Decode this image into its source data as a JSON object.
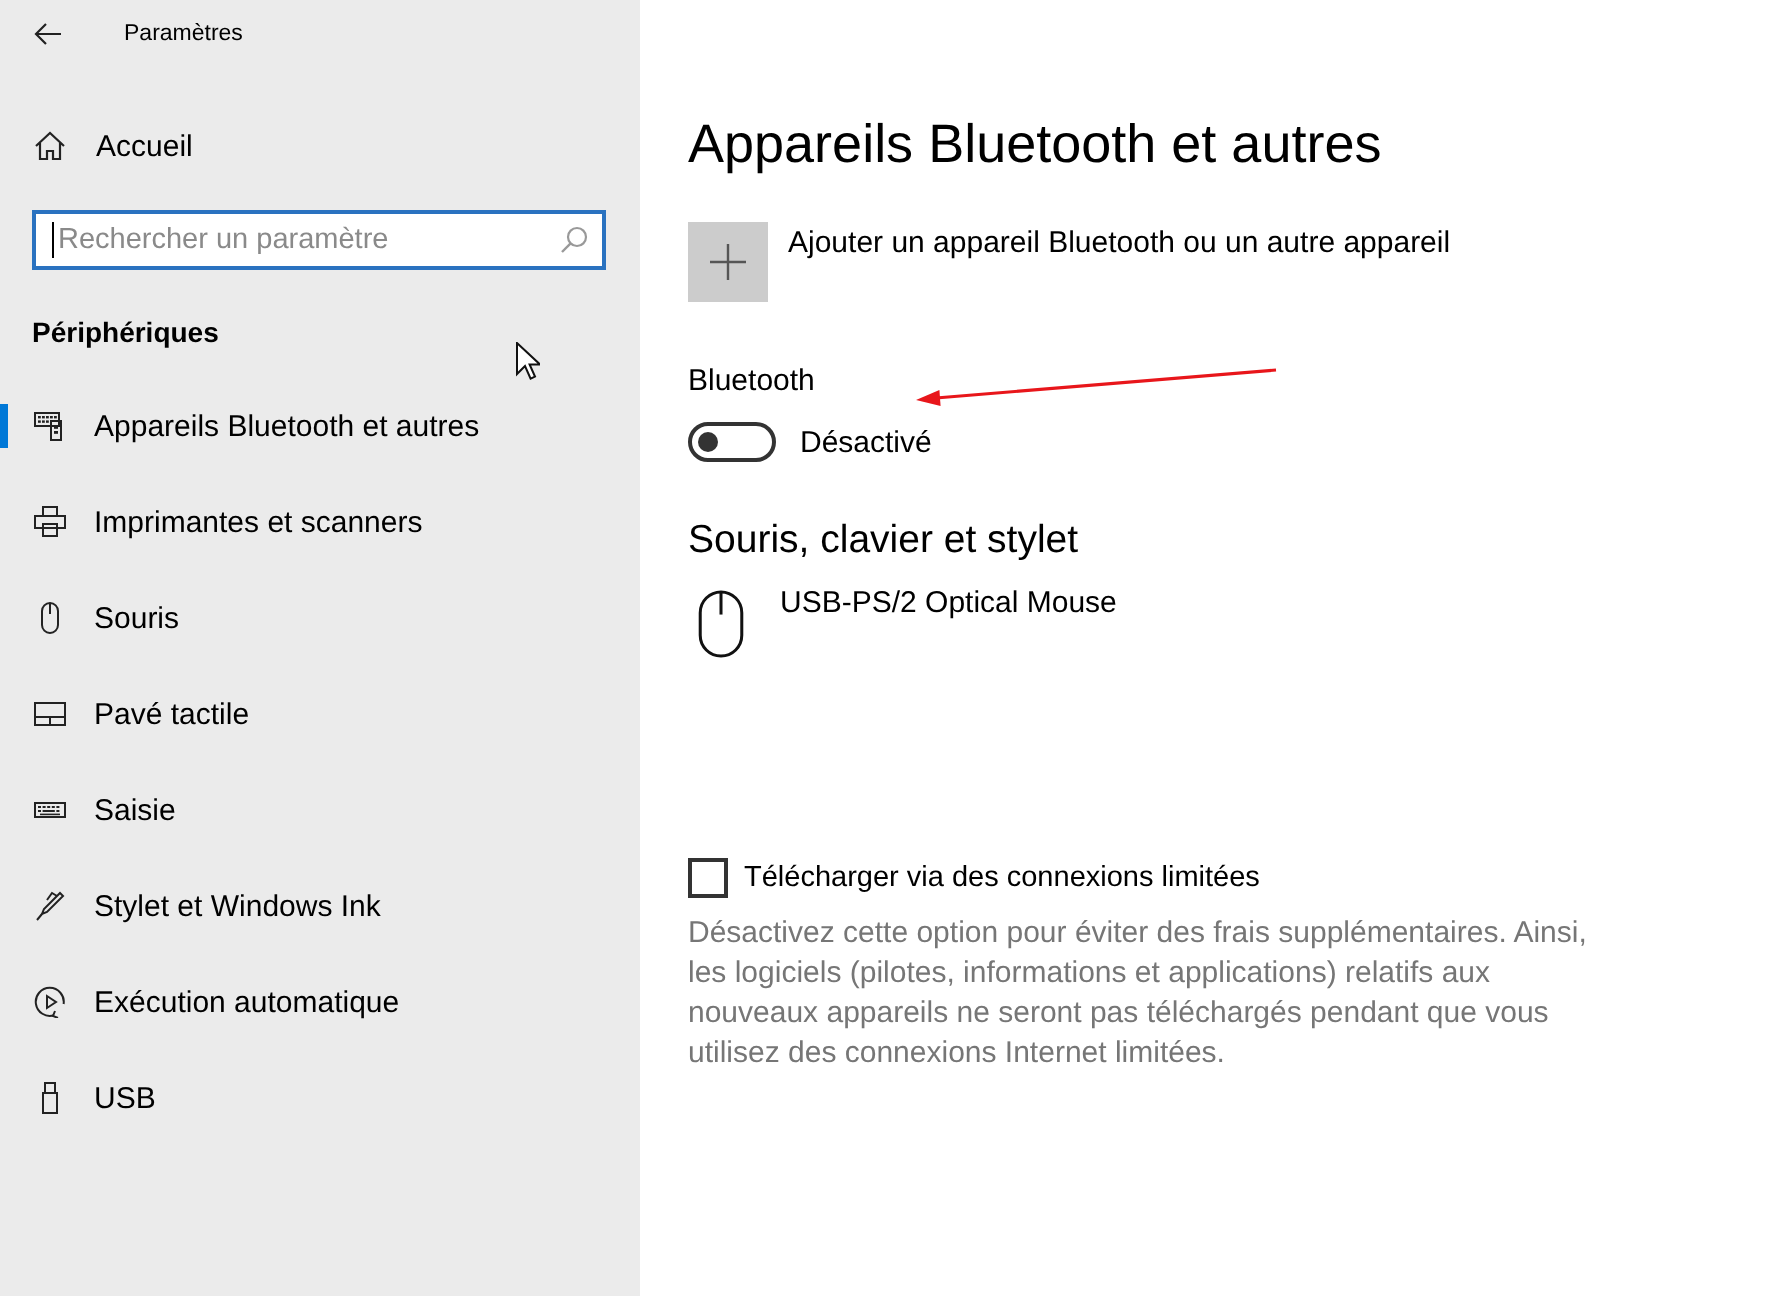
{
  "window": {
    "title": "Paramètres"
  },
  "sidebar": {
    "home": "Accueil",
    "search": {
      "placeholder": "Rechercher un paramètre"
    },
    "section": "Périphériques",
    "items": [
      {
        "label": "Appareils Bluetooth et autres",
        "kind": "devices",
        "selected": true
      },
      {
        "label": "Imprimantes et scanners",
        "kind": "printer",
        "selected": false
      },
      {
        "label": "Souris",
        "kind": "mouse",
        "selected": false
      },
      {
        "label": "Pavé tactile",
        "kind": "touchpad",
        "selected": false
      },
      {
        "label": "Saisie",
        "kind": "keyboard",
        "selected": false
      },
      {
        "label": "Stylet et Windows Ink",
        "kind": "pen",
        "selected": false
      },
      {
        "label": "Exécution automatique",
        "kind": "autoplay",
        "selected": false
      },
      {
        "label": "USB",
        "kind": "usb",
        "selected": false
      }
    ]
  },
  "page": {
    "title": "Appareils Bluetooth et autres",
    "add_device": {
      "label": "Ajouter un appareil Bluetooth ou un autre appareil"
    },
    "bluetooth": {
      "label": "Bluetooth",
      "on": false,
      "state": "Désactivé"
    },
    "sections": [
      {
        "title": "Souris, clavier et stylet",
        "devices": [
          {
            "name": "USB-PS/2 Optical Mouse",
            "kind": "mouse"
          }
        ]
      }
    ],
    "metered": {
      "label": "Télécharger via des connexions limitées",
      "checked": false,
      "description": "Désactivez cette option pour éviter des frais supplémentaires. Ainsi, les logiciels (pilotes, informations et applications) relatifs aux nouveaux appareils ne seront pas téléchargés pendant que vous utilisez des connexions Internet limitées."
    }
  }
}
